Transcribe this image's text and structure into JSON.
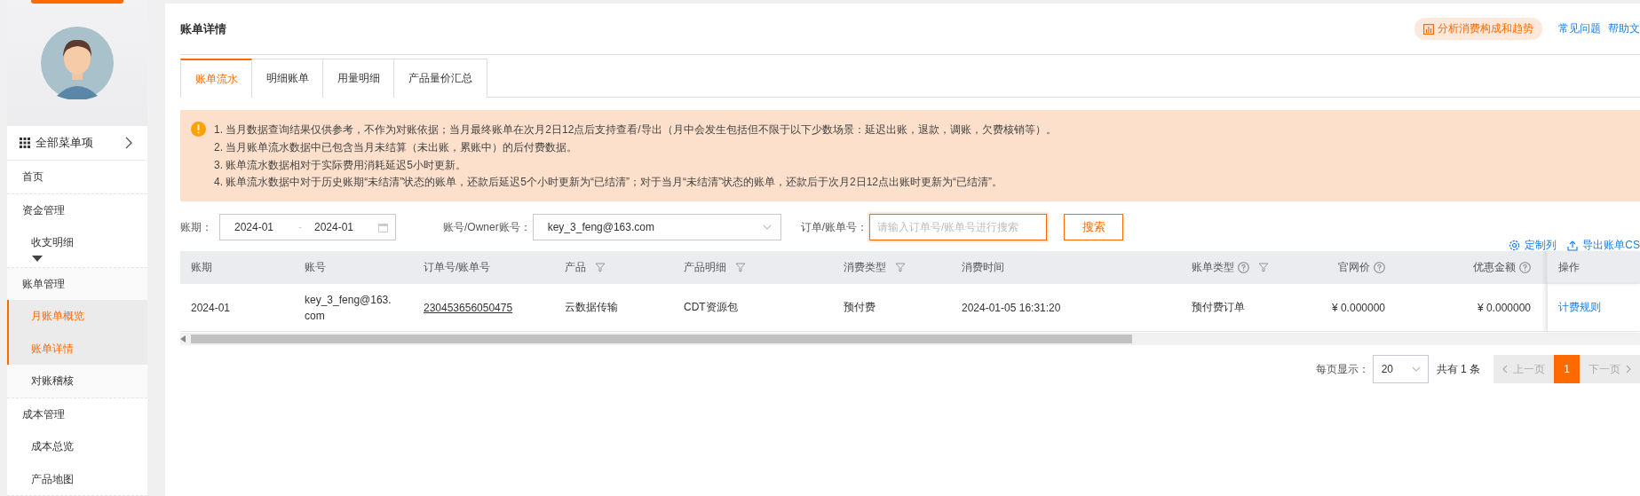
{
  "sidebar": {
    "all_menu": "全部菜单项",
    "items": [
      {
        "label": "首页",
        "active": false,
        "show_more": false
      },
      {
        "label": "资金管理",
        "active": false,
        "show_more": true,
        "children": [
          {
            "label": "收支明细",
            "selected": false
          }
        ]
      },
      {
        "label": "账单管理",
        "active": true,
        "show_more": false,
        "children": [
          {
            "label": "月账单概览",
            "selected": true
          },
          {
            "label": "账单详情",
            "selected": true
          },
          {
            "label": "对账稽核",
            "selected": false
          }
        ]
      },
      {
        "label": "成本管理",
        "active": false,
        "show_more": false,
        "children": [
          {
            "label": "成本总览",
            "selected": false
          },
          {
            "label": "产品地图",
            "selected": false
          }
        ]
      }
    ]
  },
  "header": {
    "title": "账单详情",
    "analyze_button": "分析消费构成和趋势",
    "links": [
      "常见问题",
      "帮助文"
    ]
  },
  "tabs": [
    {
      "label": "账单流水",
      "selected": true
    },
    {
      "label": "明细账单",
      "selected": false
    },
    {
      "label": "用量明细",
      "selected": false
    },
    {
      "label": "产品量价汇总",
      "selected": false
    }
  ],
  "notice": {
    "lines": [
      "1. 当月数据查询结果仅供参考，不作为对账依据；当月最终账单在次月2日12点后支持查看/导出（月中会发生包括但不限于以下少数场景：延迟出账，退款，调账，欠费核销等）。",
      "2. 当月账单流水数据中已包含当月未结算（未出账，累账中）的后付费数据。",
      "3. 账单流水数据相对于实际费用消耗延迟5小时更新。",
      "4. 账单流水数据中对于历史账期“未结清”状态的账单，还款后延迟5个小时更新为“已结清”；对于当月“未结清”状态的账单，还款后于次月2日12点出账时更新为“已结清”。"
    ]
  },
  "filters": {
    "period_label": "账期：",
    "period_start": "2024-01",
    "period_separator": "-",
    "period_end": "2024-01",
    "account_label": "账号/Owner账号：",
    "account_value": "key_3_feng@163.com",
    "order_label": "订单/账单号：",
    "order_placeholder": "请输入订单号/账单号进行搜索",
    "search_button": "搜索",
    "customize_columns": "定制列",
    "export": "导出账单CS"
  },
  "table": {
    "columns": [
      {
        "label": "账期",
        "kind": "text",
        "help": false,
        "filter": false
      },
      {
        "label": "账号",
        "kind": "text",
        "help": false,
        "filter": false
      },
      {
        "label": "订单号/账单号",
        "kind": "underline-link",
        "help": false,
        "filter": false
      },
      {
        "label": "产品",
        "kind": "text",
        "help": false,
        "filter": true
      },
      {
        "label": "产品明细",
        "kind": "text",
        "help": false,
        "filter": true
      },
      {
        "label": "消费类型",
        "kind": "text",
        "help": false,
        "filter": true
      },
      {
        "label": "消费时间",
        "kind": "text",
        "help": false,
        "filter": false
      },
      {
        "label": "账单类型",
        "kind": "text",
        "help": true,
        "filter": true
      },
      {
        "label": "官网价",
        "kind": "amount",
        "help": true,
        "filter": false
      },
      {
        "label": "优惠金额",
        "kind": "amount",
        "help": true,
        "filter": false
      },
      {
        "label": "操作",
        "kind": "action-link",
        "help": false,
        "filter": false
      }
    ],
    "rows": [
      {
        "cells": [
          "2024-01",
          "key_3_feng@163.com",
          "230453656050475",
          "云数据传输",
          "CDT资源包",
          "预付费",
          "2024-01-05 16:31:20",
          "预付费订单",
          "¥ 0.000000",
          "¥ 0.000000",
          "计费规则"
        ]
      }
    ]
  },
  "pagination": {
    "page_size_label": "每页显示：",
    "page_size": "20",
    "total": "共有 1 条",
    "prev": {
      "label": "上一页",
      "disabled": true
    },
    "pages": [
      {
        "label": "1",
        "selected": true
      }
    ],
    "next": {
      "label": "下一页",
      "disabled": true
    }
  }
}
